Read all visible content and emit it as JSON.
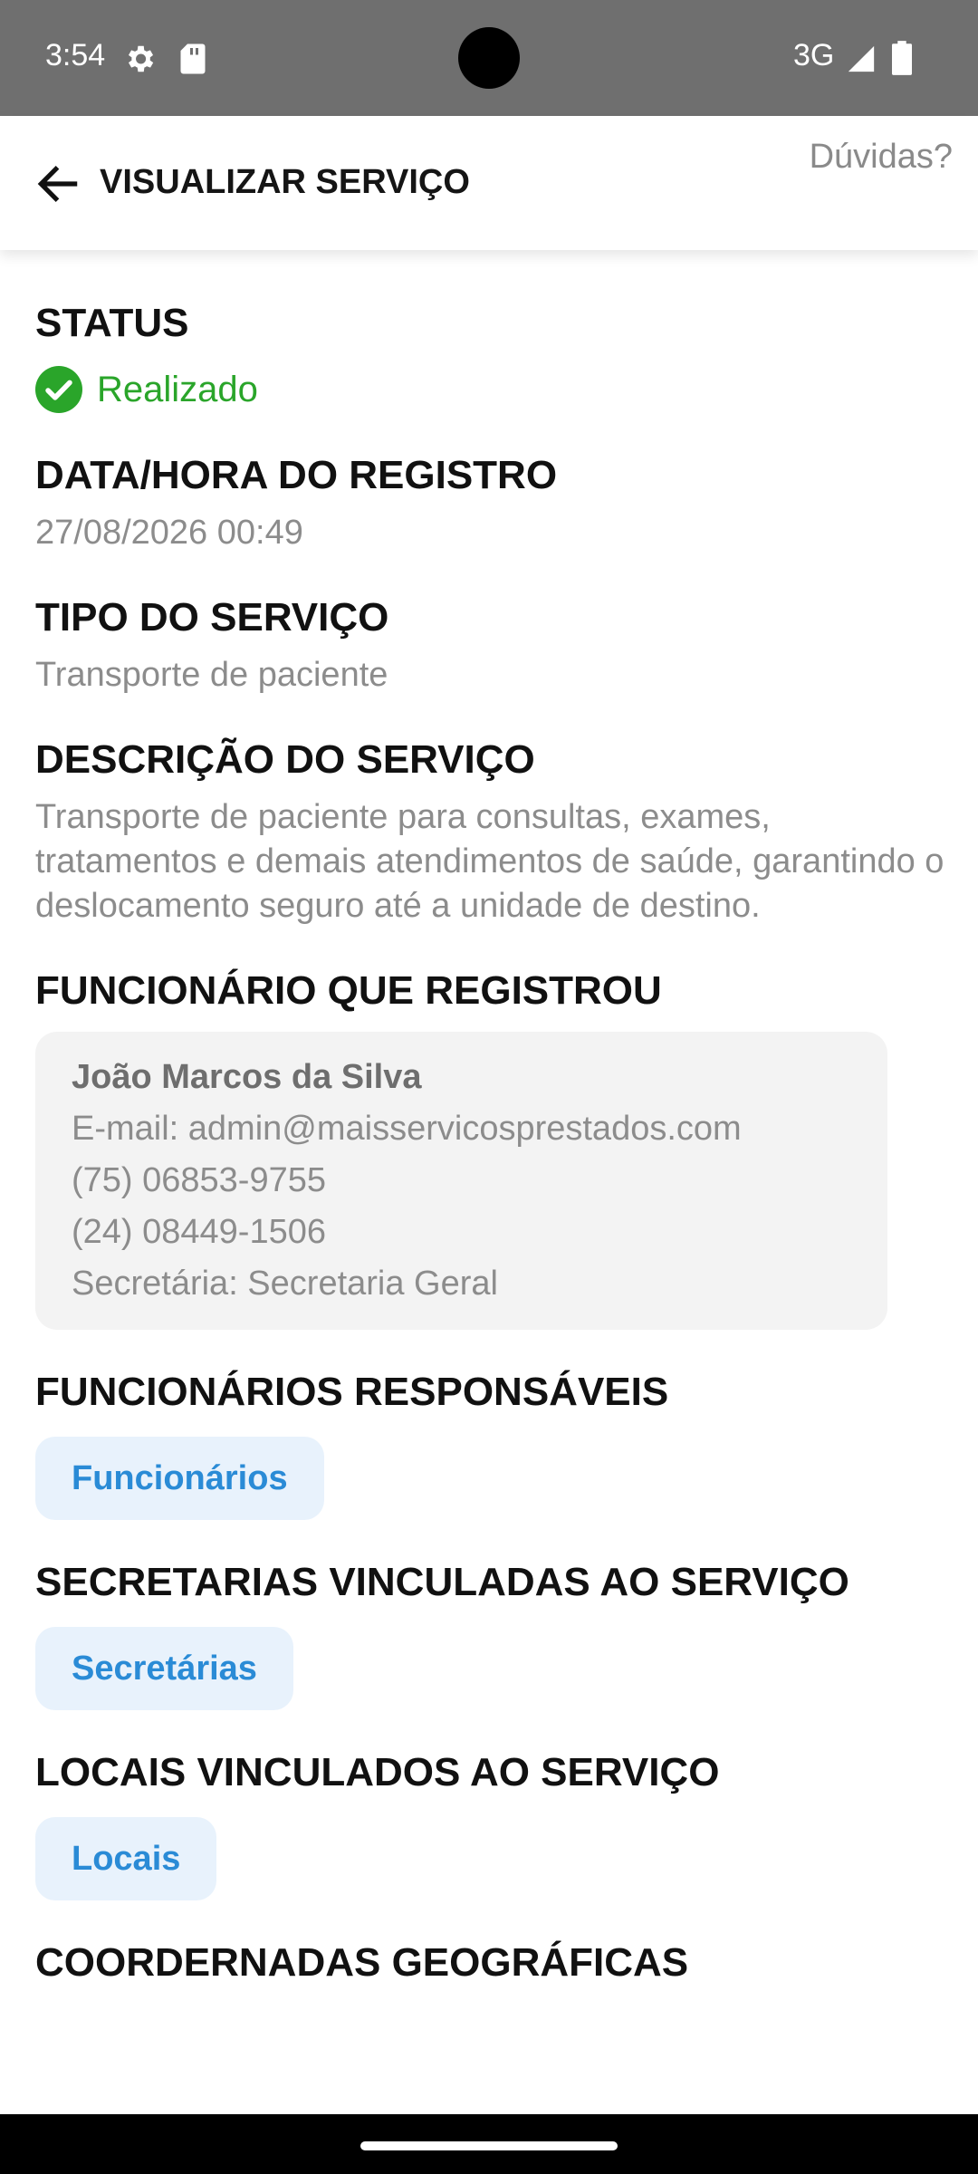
{
  "status_bar": {
    "time": "3:54",
    "network": "3G"
  },
  "app_bar": {
    "title": "VISUALIZAR SERVIÇO",
    "help": "Dúvidas?"
  },
  "status": {
    "label": "STATUS",
    "value": "Realizado",
    "color": "#2aa52a"
  },
  "registro": {
    "label": "DATA/HORA DO REGISTRO",
    "value": "27/08/2026 00:49"
  },
  "tipo": {
    "label": "TIPO DO SERVIÇO",
    "value": "Transporte de paciente"
  },
  "descricao": {
    "label": "DESCRIÇÃO DO SERVIÇO",
    "value": "Transporte de paciente para consultas, exames, tratamentos e demais atendimentos de saúde, garantindo o deslocamento seguro até a unidade de destino."
  },
  "funcionario": {
    "label": "FUNCIONÁRIO QUE REGISTROU",
    "name": "João Marcos da Silva",
    "email": "E-mail: admin@maisservicosprestados.com",
    "phone1": "(75) 06853-9755",
    "phone2": "(24) 08449-1506",
    "secretaria": "Secretária: Secretaria Geral"
  },
  "responsaveis": {
    "label": "FUNCIONÁRIOS RESPONSÁVEIS",
    "button": "Funcionários"
  },
  "secretarias": {
    "label": "SECRETARIAS VINCULADAS AO SERVIÇO",
    "button": "Secretárias"
  },
  "locais": {
    "label": "LOCAIS VINCULADOS AO SERVIÇO",
    "button": "Locais"
  },
  "coordenadas": {
    "label": "COORDERNADAS GEOGRÁFICAS"
  },
  "colors": {
    "accent": "#2a8bd6",
    "chip_bg": "#e8f2fc",
    "success": "#2aa52a"
  }
}
